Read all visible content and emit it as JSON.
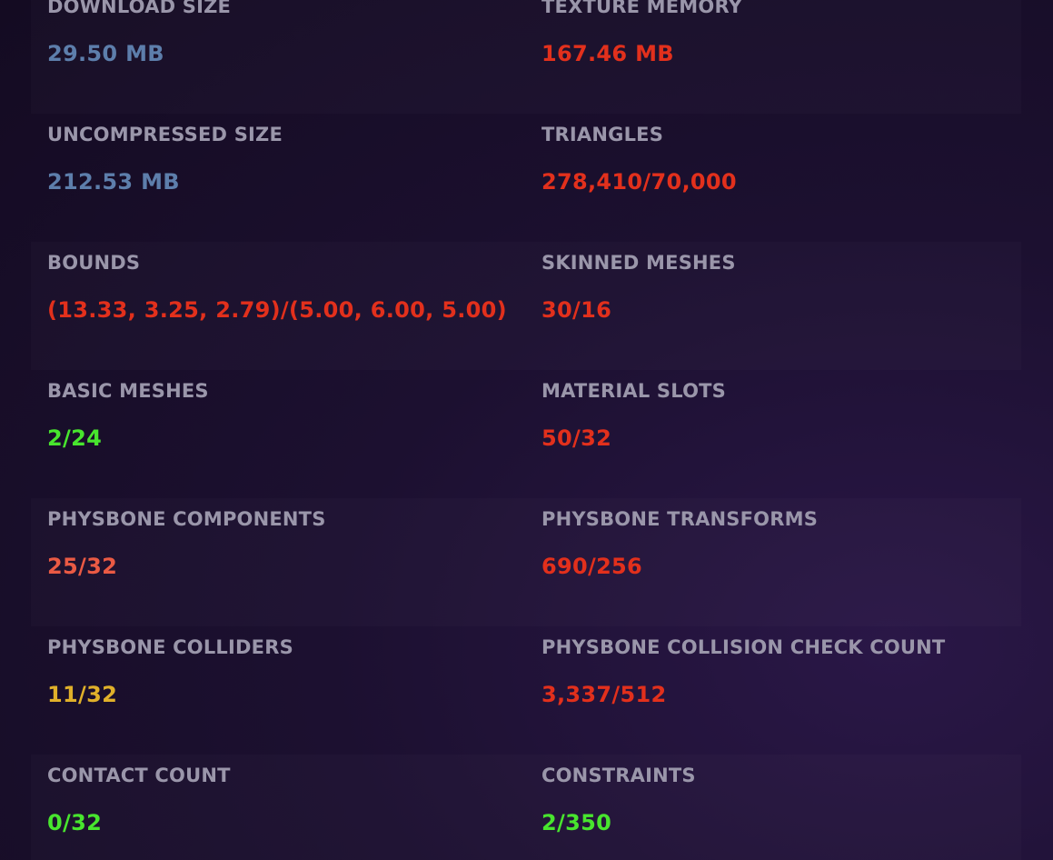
{
  "colors": {
    "label": "#9a96aa",
    "good": "#48e52e",
    "neutral": "#5d7eab",
    "medium": "#e0b02a",
    "poor": "#ea5a44",
    "very_poor": "#e2301c"
  },
  "stats": {
    "download_size": {
      "label": "DOWNLOAD SIZE",
      "value": "29.50 MB"
    },
    "texture_memory": {
      "label": "TEXTURE MEMORY",
      "value": "167.46 MB"
    },
    "uncompressed_size": {
      "label": "UNCOMPRESSED SIZE",
      "value": "212.53 MB"
    },
    "triangles": {
      "label": "TRIANGLES",
      "value": "278,410/70,000"
    },
    "bounds": {
      "label": "BOUNDS",
      "value": "(13.33, 3.25, 2.79)/(5.00, 6.00, 5.00)"
    },
    "skinned_meshes": {
      "label": "SKINNED MESHES",
      "value": "30/16"
    },
    "basic_meshes": {
      "label": "BASIC MESHES",
      "value": "2/24"
    },
    "material_slots": {
      "label": "MATERIAL SLOTS",
      "value": "50/32"
    },
    "physbone_components": {
      "label": "PHYSBONE COMPONENTS",
      "value": "25/32"
    },
    "physbone_transforms": {
      "label": "PHYSBONE TRANSFORMS",
      "value": "690/256"
    },
    "physbone_colliders": {
      "label": "PHYSBONE COLLIDERS",
      "value": "11/32"
    },
    "physbone_collision_check_count": {
      "label": "PHYSBONE COLLISION CHECK COUNT",
      "value": "3,337/512"
    },
    "contact_count": {
      "label": "CONTACT COUNT",
      "value": "0/32"
    },
    "constraints": {
      "label": "CONSTRAINTS",
      "value": "2/350"
    }
  }
}
